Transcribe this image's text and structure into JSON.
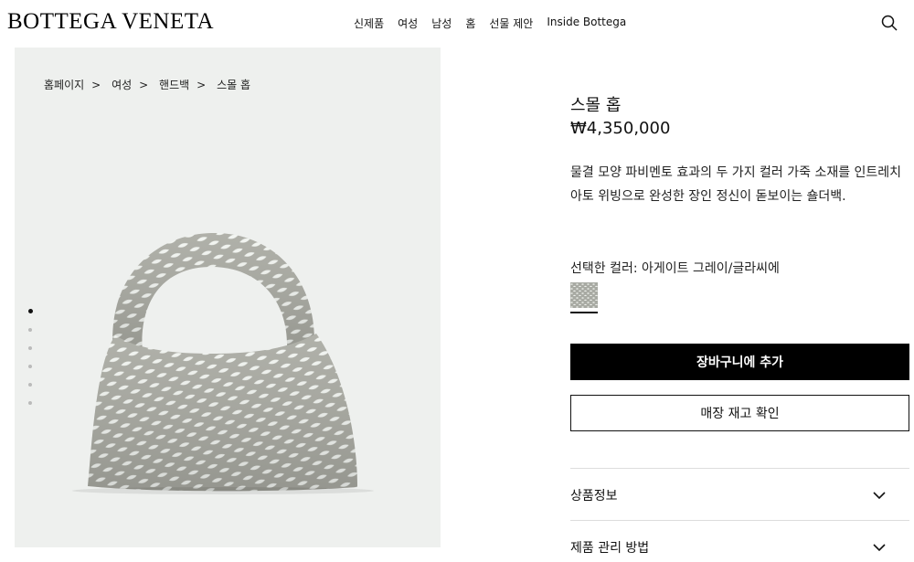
{
  "header": {
    "logo": "BOTTEGA VENETA",
    "nav": [
      "신제품",
      "여성",
      "남성",
      "홈",
      "선물 제안",
      "Inside Bottega"
    ]
  },
  "breadcrumb": {
    "items": [
      "홈페이지",
      "여성",
      "핸드백",
      "스몰 홉"
    ],
    "separator": ">"
  },
  "gallery": {
    "dot_count": 6,
    "active_dot": 1
  },
  "product": {
    "title": "스몰 홉",
    "price": "₩4,350,000",
    "description": "물결 모양 파비멘토 효과의 두 가지 컬러 가죽 소재를 인트레치아토 위빙으로 완성한 장인 정신이 돋보이는 숄더백.",
    "color_label": "선택한 컬러: 아게이트 그레이/글라씨에",
    "colors": {
      "swatch_primary": "#a8aaa3",
      "swatch_secondary": "#eef1ec",
      "bag_dark": "#a9aaa2",
      "bag_light": "#f2f5f1"
    },
    "add_to_cart": "장바구니에 추가",
    "check_stock": "매장 재고 확인",
    "accordion": [
      "상품정보",
      "제품 관리 방법"
    ]
  }
}
